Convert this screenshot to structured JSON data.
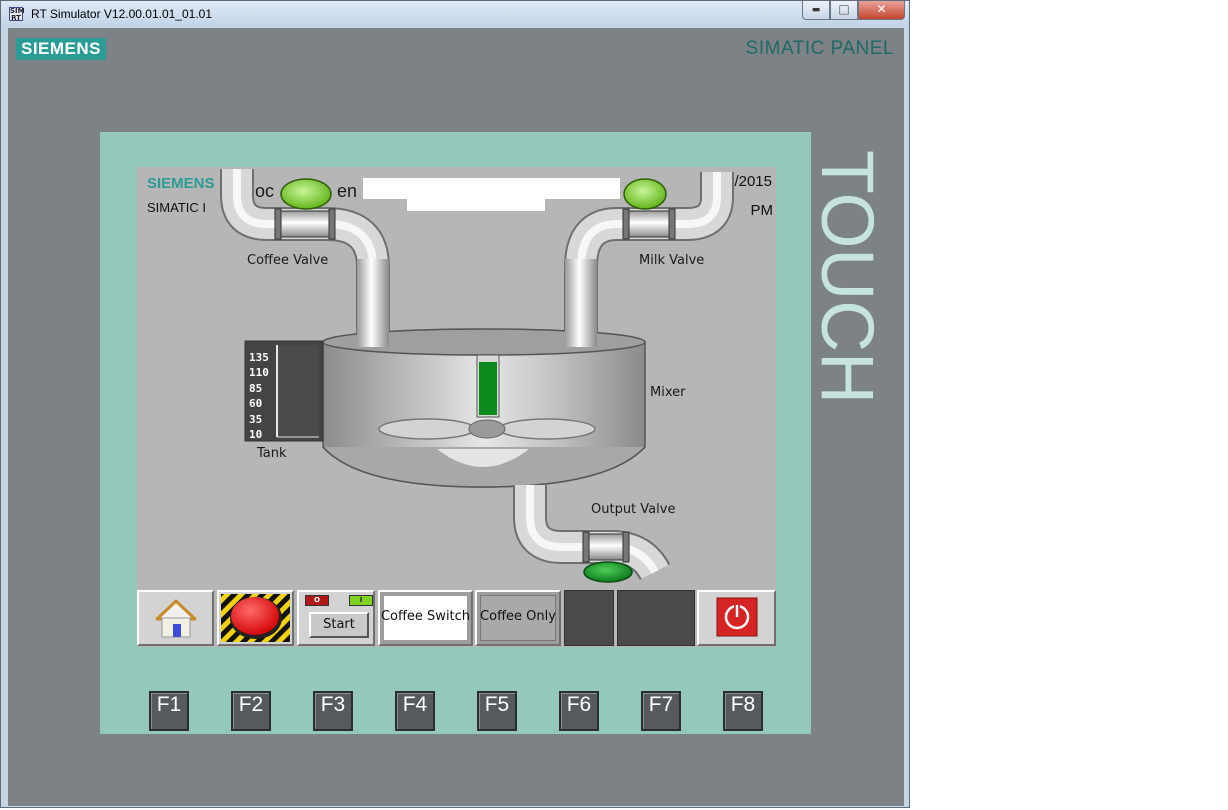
{
  "window": {
    "title": "RT Simulator V12.00.01.01_01.01",
    "app_icon_text": "SIM RT",
    "minimize_glyph": "▬",
    "maximize_glyph": "□",
    "close_glyph": "✕"
  },
  "panel": {
    "logo": "SIEMENS",
    "brand": "SIMATIC PANEL",
    "touch_label": "TOUCH"
  },
  "hmi": {
    "header": {
      "siemens": "SIEMENS",
      "simatic": "SIMATIC I",
      "title_fragment_1": "oc",
      "title_fragment_2": "en",
      "date_fragment": "/2015",
      "time_fragment": "PM"
    },
    "labels": {
      "coffee_valve": "Coffee Valve",
      "milk_valve": "Milk Valve",
      "mixer": "Mixer",
      "output_valve": "Output Valve",
      "tank": "Tank"
    },
    "tank_scale": [
      "135",
      "110",
      "85",
      "60",
      "35",
      "10"
    ],
    "buttons": {
      "start": "Start",
      "coffee_switch": "Coffee Switch",
      "coffee_only": "Coffee Only",
      "start_indicator_on": "I",
      "start_indicator_off": "O"
    },
    "colors": {
      "indicator_on": "#7ed321",
      "indicator_output": "#1e9a2a",
      "mixer_level": "#0c8a1e",
      "estop": "#e52222",
      "power_button": "#d42424"
    }
  },
  "function_keys": [
    "F1",
    "F2",
    "F3",
    "F4",
    "F5",
    "F6",
    "F7",
    "F8"
  ]
}
